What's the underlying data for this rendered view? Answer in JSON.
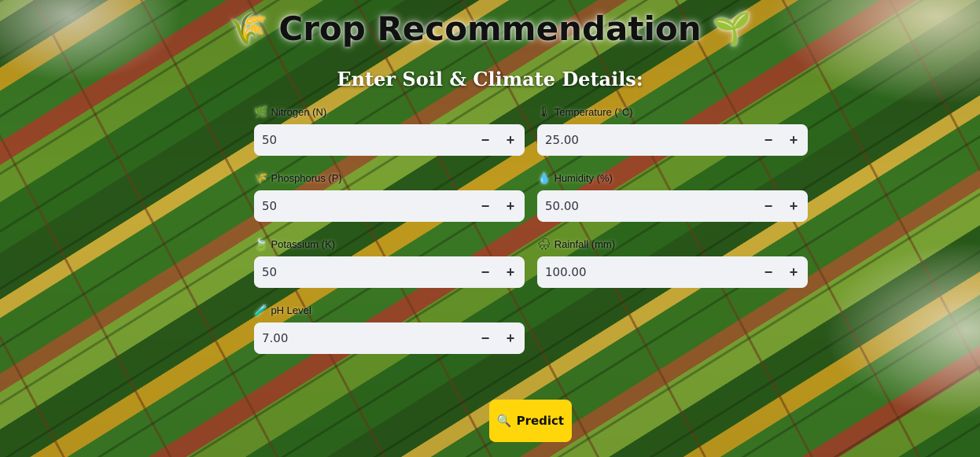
{
  "header": {
    "title": "Crop Recommendation",
    "left_emoji": "🌾",
    "right_emoji": "🌱"
  },
  "subtitle": "Enter Soil & Climate Details:",
  "fields": {
    "nitrogen": {
      "icon": "🌿",
      "label": "Nitrogen (N)",
      "value": "50"
    },
    "phosphorus": {
      "icon": "🌾",
      "label": "Phosphorus (P)",
      "value": "50"
    },
    "potassium": {
      "icon": "🍃",
      "label": "Potassium (K)",
      "value": "50"
    },
    "ph": {
      "icon": "🧪",
      "label": "pH Level",
      "value": "7.00"
    },
    "temperature": {
      "icon": "🌡",
      "label": "Temperature (°C)",
      "value": "25.00"
    },
    "humidity": {
      "icon": "💧",
      "label": "Humidity (%)",
      "value": "50.00"
    },
    "rainfall": {
      "icon": "🌧",
      "label": "Rainfall (mm)",
      "value": "100.00"
    }
  },
  "stepper": {
    "minus": "−",
    "plus": "+"
  },
  "predict": {
    "icon": "🔍",
    "label": "Predict"
  }
}
